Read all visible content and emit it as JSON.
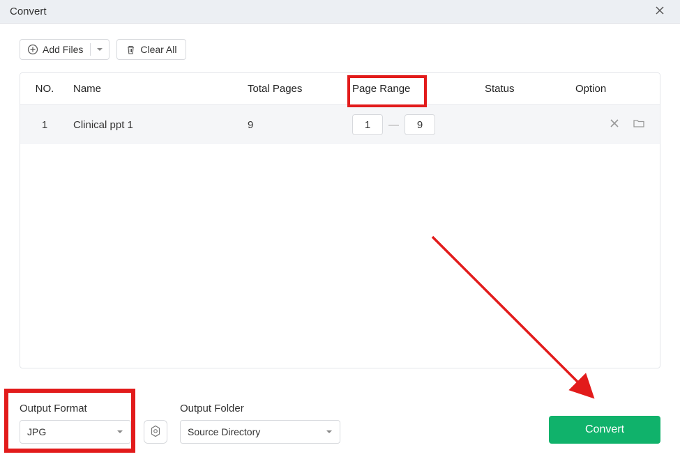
{
  "window": {
    "title": "Convert"
  },
  "toolbar": {
    "add_files_label": "Add Files",
    "clear_all_label": "Clear All"
  },
  "columns": {
    "no": "NO.",
    "name": "Name",
    "total_pages": "Total Pages",
    "page_range": "Page Range",
    "status": "Status",
    "option": "Option"
  },
  "rows": [
    {
      "no": "1",
      "name": "Clinical ppt 1",
      "total_pages": "9",
      "range_from": "1",
      "range_to": "9",
      "status": ""
    }
  ],
  "footer": {
    "output_format_label": "Output Format",
    "output_format_value": "JPG",
    "output_folder_label": "Output Folder",
    "output_folder_value": "Source Directory",
    "convert_label": "Convert"
  },
  "colors": {
    "accent": "#10b26b",
    "annotation": "#e21b1b"
  }
}
